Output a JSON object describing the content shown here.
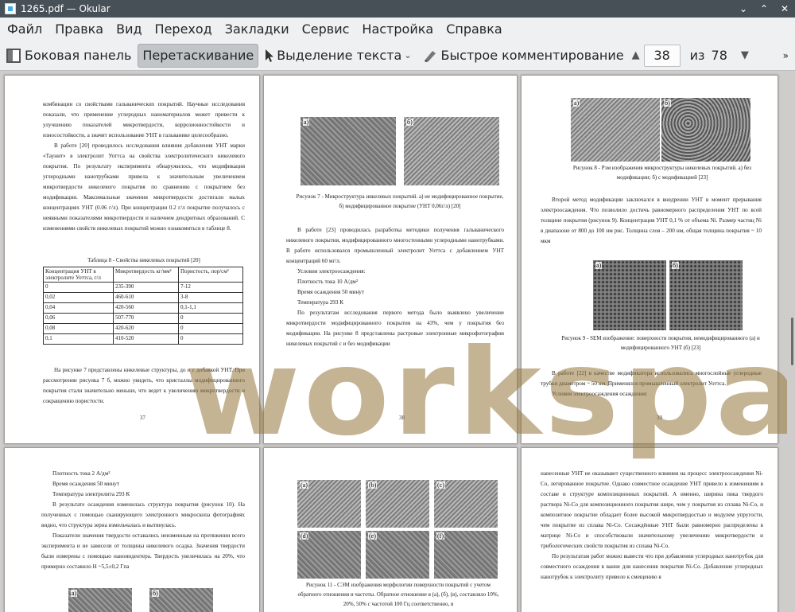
{
  "window": {
    "title": "1265.pdf  — Okular"
  },
  "menu": [
    "Файл",
    "Правка",
    "Вид",
    "Переход",
    "Закладки",
    "Сервис",
    "Настройка",
    "Справка"
  ],
  "toolbar": {
    "sidebar": "Боковая панель",
    "drag": "Перетаскивание",
    "select_text": "Выделение текста",
    "quick_comment": "Быстрое комментирование",
    "page_current": "38",
    "of_label": "из",
    "page_total": "78"
  },
  "watermark": "workspay.",
  "pages": {
    "p37": {
      "para1": "комбинации со свойствами гальванических покрытий. Научные исследования показали, что применение углеродных наноматериалов может привести к улучшению показателей микротвердости, коррозионностойкости и износостойкости, а значит использование УНТ в гальванике целесообразно.",
      "para2": "В работе [20] проводилось исследования влияния добавления УНТ марки «Таунит» в электролит Уоттса на свойства электролитического никелевого покрытия. По результату эксперимента обнаружилось, что модификация углеродными нанотрубками привела к значительным увеличением микротвердости никелевого покрытия по сравнению с покрытием без модификации. Максимальные значения микротвердости достигали малых концентрациях УНТ (0.06 г/л). При концентрации 0.2 г/л покрытие получалось с неявными показателями микротвердости и наличием дендритных образований. С изменениями свойств никелевых покрытий можно ознакомиться в таблице 8.",
      "table_title": "Таблица 8 - Свойства никелевых покрытий [20]",
      "table_head": [
        "Концентрация УНТ в электролите Уоттса, г/л",
        "Микротвердость кг/мм²",
        "Пористость, пор/см²"
      ],
      "table_rows": [
        [
          "0",
          "235-390",
          "7-12"
        ],
        [
          "0,02",
          "460-610",
          "3-8"
        ],
        [
          "0,04",
          "420-560",
          "0,1-1,1"
        ],
        [
          "0,06",
          "507-770",
          "0"
        ],
        [
          "0,08",
          "420-620",
          "0"
        ],
        [
          "0,1",
          "410-520",
          "0"
        ]
      ],
      "para3": "На рисунке 7 представлены никелевые структуры, до и с добавкой УНТ. При рассмотрении рисунка 7 б, можно увидеть, что кристаллы модифицированного покрытия стали значительно меньше, что ведет к увеличению микротвердости и сокращению пористости.",
      "num": "37"
    },
    "p38": {
      "img_a": "а)",
      "img_b": "б)",
      "cap": "Рисунок 7 - Микроструктура никелевых покрытий. а) не модифицированное покрытие, б) модифицированное покрытие (УНТ 0,06г/л) [20]",
      "para1": "В работе [23] проводилась разработка методики получения гальванического никелевого покрытия, модифицированного многостенными углеродными нанотрубками. В работе использовался промышленный электролит Уоттса с добавлением УНТ концентраций 60 мг/л.",
      "cond_title": "Условия электроосаждения:",
      "cond1": "Плотность тока 10 А/дм²",
      "cond2": "Время осаждения 50 минут",
      "cond3": "Температура 293 К",
      "para2": "По результатам исследования первого метода было выявлено увеличение микротвердости модифицированного покрытия на 43%, чем у покрытия без модификации. На рисунке 8 представлены растровые электронные микрофотографии никелевых покрытий с и без модификации",
      "num": "38"
    },
    "p39": {
      "img_a": "а)",
      "img_b": "б)",
      "cap8": "Рисунок 8 - Рэм изображения микроструктуры никелевых покрытий. а) без модификации; б) с модификацией [23]",
      "para1": "Второй метод модификации заключался в внедрении УНТ в момент прерывания электроосаждения. Что позволило достичь равномерного распределения УНТ по всей толщине покрытия (рисунок 9). Концентрация УНТ 0,1 % от объема Ni. Размер частиц Ni в диапазоне от 800 до 100 нм рис. Толщина слоя – 200 нм, общая толщина покрытия ~ 10 мкм",
      "img_c": "а)",
      "img_d": "б)",
      "cap9": "Рисунок 9 - SEM изображение: поверхности покрытия, немодифицированного (а) и модифицированного УНТ (б) [23]",
      "para2": "В работе [22] в качестве модификатора использовались многослойные углеродные трубки диаметром ~ 50 нм. Применялся промышленный электролит Уоттса.",
      "para3": "Условия электроосаждения осаждения:",
      "num": "39"
    },
    "p40": {
      "cond1": "Плотность тока 2 А/дм²",
      "cond2": "Время осаждения 50 минут",
      "cond3": "Температура электролита 293 К",
      "para1": "В результате осаждения изменилась структура покрытия (рисунок 10). На полученных с помощью сканирующего электронного микроскопа фотографиях видно, что структура зерна измельчалась и вытянулась.",
      "para2": "Показатели значения твердости оставались неизменным на протяжении всего эксперимента и не зависели от толщины никелевого осадка. Значения твердости были измерены с помощью наноиндентера. Твердость увеличилась на 20%, что примерно составило H ~5,5±0,2 Гпа",
      "img_a": "а)",
      "img_b": "б)"
    },
    "p41": {
      "labels": [
        "(a)",
        "(b)",
        "(c)",
        "(d)",
        "(e)",
        "(f)"
      ],
      "cap": "Рисунок 11 - СЭМ изображения морфологии поверхности покрытий с учетом обратного отношения и частоты. Обратное отношение в (а), (б), (в), составляло 10%, 20%, 50% с частотой 100 Гц соответственно, в"
    },
    "p42": {
      "para1": "нанесенные УНТ не оказывают существенного влияния на процесс электроосаждения Ni-Co, легированное покрытие. Однако совместное осаждение УНТ привело к изменениям в составе и структуре композиционных покрытий. А именно, ширина пика твердого раствора Ni-Co для композиционного покрытия шире, чем у покрытия из сплава Ni-Co, и композитное покрытие обладает более высокой микротвердостью и модулем упругости, чем покрытие из сплава Ni-Co. Сосаждённые УНТ были равномерно распределены в матрице Ni-Co и способствовали значительному увеличению микротвердости и трибологических свойств покрытия из сплава Ni-Co.",
      "para2": "По результатам работ можно вывести что при добавлении углеродных нанотрубок для совместного осаждения в ванне для нанесения покрытия Ni-Co. Добавление углеродных нанотрубок к электролиту привело к смещению в"
    }
  }
}
